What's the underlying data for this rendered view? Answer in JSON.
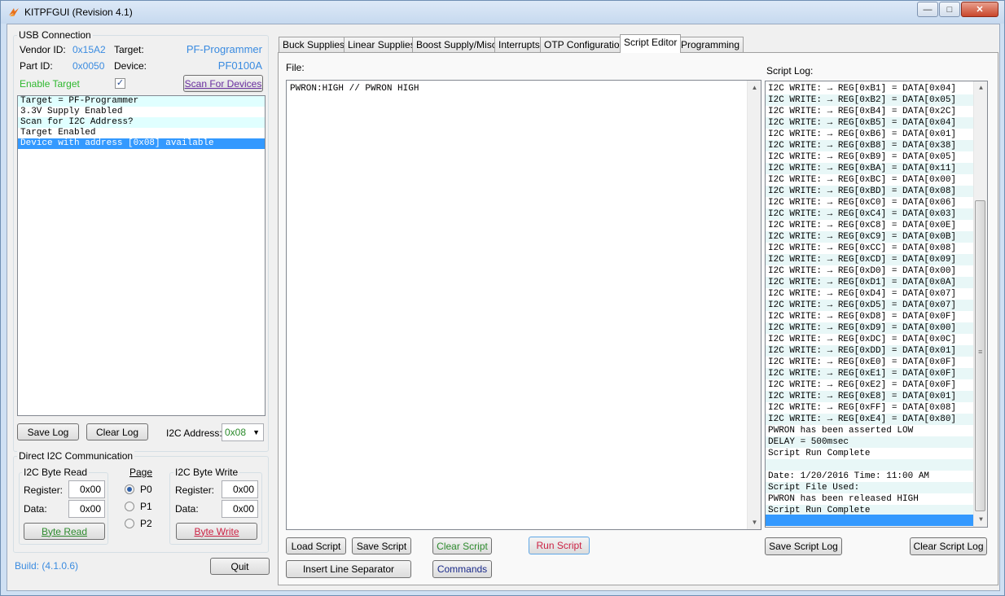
{
  "window": {
    "title": "KITPFGUI (Revision 4.1)",
    "controls": {
      "minimize": "—",
      "maximize": "□",
      "close": "✕"
    }
  },
  "usb": {
    "group_title": "USB Connection",
    "vendor_label": "Vendor ID:",
    "vendor_value": "0x15A2",
    "target_label": "Target:",
    "target_value": "PF-Programmer",
    "part_label": "Part ID:",
    "part_value": "0x0050",
    "device_label": "Device:",
    "device_value": "PF0100A",
    "enable_label": "Enable Target",
    "enable_checked": true,
    "scan_button": "Scan For Devices"
  },
  "log": {
    "lines": [
      "Target = PF-Programmer",
      "3.3V Supply Enabled",
      "Scan for I2C Address?",
      "Target Enabled",
      "Device with address [0x08] available"
    ],
    "selected_index": 4,
    "save_button": "Save Log",
    "clear_button": "Clear Log",
    "i2c_address_label": "I2C Address:",
    "i2c_address_value": "0x08"
  },
  "direct_i2c": {
    "group_title": "Direct I2C Communication",
    "read": {
      "title": "I2C Byte Read",
      "register_label": "Register:",
      "register_value": "0x00",
      "data_label": "Data:",
      "data_value": "0x00",
      "button": "Byte Read"
    },
    "page": {
      "title": "Page",
      "options": [
        "P0",
        "P1",
        "P2"
      ],
      "selected": "P0"
    },
    "write": {
      "title": "I2C Byte Write",
      "register_label": "Register:",
      "register_value": "0x00",
      "data_label": "Data:",
      "data_value": "0x00",
      "button": "Byte Write"
    }
  },
  "footer": {
    "build": "Build: (4.1.0.6)",
    "quit_button": "Quit"
  },
  "tabs": [
    "Buck Supplies",
    "Linear Supplies",
    "Boost Supply/Misc",
    "Interrupts",
    "OTP Configuration",
    "Script Editor",
    "Programming"
  ],
  "active_tab": "Script Editor",
  "script_editor": {
    "file_label": "File:",
    "content": "PWRON:HIGH // PWRON HIGH",
    "buttons": {
      "load": "Load Script",
      "save": "Save Script",
      "clear": "Clear Script",
      "run": "Run Script",
      "insert_separator": "Insert Line Separator",
      "commands": "Commands"
    }
  },
  "script_log": {
    "label": "Script Log:",
    "lines": [
      "I2C WRITE: → REG[0xB1] = DATA[0x04]",
      "I2C WRITE: → REG[0xB2] = DATA[0x05]",
      "I2C WRITE: → REG[0xB4] = DATA[0x2C]",
      "I2C WRITE: → REG[0xB5] = DATA[0x04]",
      "I2C WRITE: → REG[0xB6] = DATA[0x01]",
      "I2C WRITE: → REG[0xB8] = DATA[0x38]",
      "I2C WRITE: → REG[0xB9] = DATA[0x05]",
      "I2C WRITE: → REG[0xBA] = DATA[0x11]",
      "I2C WRITE: → REG[0xBC] = DATA[0x00]",
      "I2C WRITE: → REG[0xBD] = DATA[0x08]",
      "I2C WRITE: → REG[0xC0] = DATA[0x06]",
      "I2C WRITE: → REG[0xC4] = DATA[0x03]",
      "I2C WRITE: → REG[0xC8] = DATA[0x0E]",
      "I2C WRITE: → REG[0xC9] = DATA[0x0B]",
      "I2C WRITE: → REG[0xCC] = DATA[0x08]",
      "I2C WRITE: → REG[0xCD] = DATA[0x09]",
      "I2C WRITE: → REG[0xD0] = DATA[0x00]",
      "I2C WRITE: → REG[0xD1] = DATA[0x0A]",
      "I2C WRITE: → REG[0xD4] = DATA[0x07]",
      "I2C WRITE: → REG[0xD5] = DATA[0x07]",
      "I2C WRITE: → REG[0xD8] = DATA[0x0F]",
      "I2C WRITE: → REG[0xD9] = DATA[0x00]",
      "I2C WRITE: → REG[0xDC] = DATA[0x0C]",
      "I2C WRITE: → REG[0xDD] = DATA[0x01]",
      "I2C WRITE: → REG[0xE0] = DATA[0x0F]",
      "I2C WRITE: → REG[0xE1] = DATA[0x0F]",
      "I2C WRITE: → REG[0xE2] = DATA[0x0F]",
      "I2C WRITE: → REG[0xE8] = DATA[0x01]",
      "I2C WRITE: → REG[0xFF] = DATA[0x08]",
      "I2C WRITE: → REG[0xE4] = DATA[0x80]",
      "PWRON has been asserted LOW",
      "DELAY = 500msec",
      "Script Run Complete",
      "",
      "Date: 1/20/2016 Time: 11:00 AM",
      "Script File Used:",
      "PWRON has been released HIGH",
      "Script Run Complete"
    ],
    "save_button": "Save Script Log",
    "clear_button": "Clear Script Log"
  },
  "colors": {
    "accent_blue": "#3a8be0",
    "enable_green": "#2eb82e",
    "byte_read_green": "#2e8b2e",
    "byte_write_red": "#cc2244",
    "run_red": "#cc2244",
    "selection": "#3399ff"
  },
  "icons": {
    "app": "kitpfgui-logo-icon",
    "scroll_up": "scroll-up-icon",
    "scroll_down": "scroll-down-icon"
  }
}
